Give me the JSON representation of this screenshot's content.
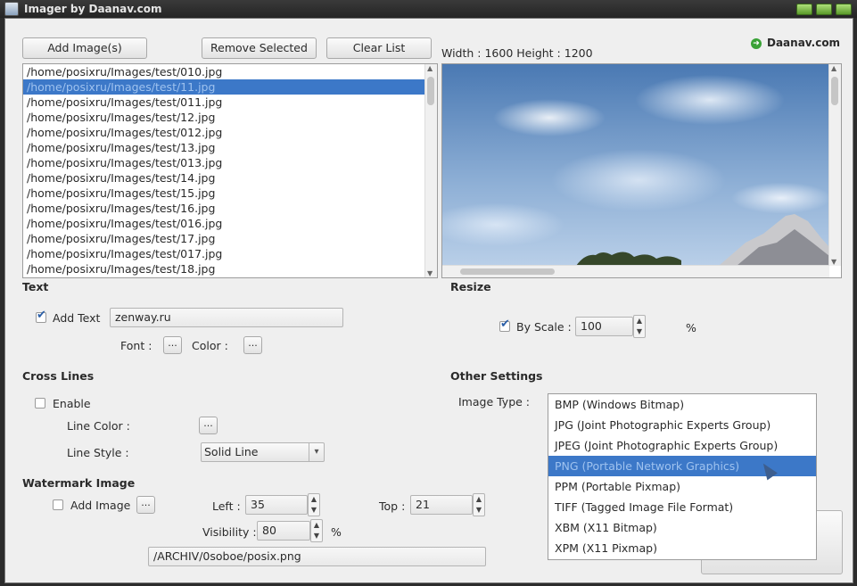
{
  "window": {
    "title": "Imager by Daanav.com"
  },
  "toolbar": {
    "add": "Add Image(s)",
    "remove": "Remove Selected",
    "clear": "Clear List"
  },
  "brand": "Daanav.com",
  "preview": {
    "dims": "Width : 1600 Height : 1200"
  },
  "files": [
    "/home/posixru/Images/test/010.jpg",
    "/home/posixru/Images/test/11.jpg",
    "/home/posixru/Images/test/011.jpg",
    "/home/posixru/Images/test/12.jpg",
    "/home/posixru/Images/test/012.jpg",
    "/home/posixru/Images/test/13.jpg",
    "/home/posixru/Images/test/013.jpg",
    "/home/posixru/Images/test/14.jpg",
    "/home/posixru/Images/test/15.jpg",
    "/home/posixru/Images/test/16.jpg",
    "/home/posixru/Images/test/016.jpg",
    "/home/posixru/Images/test/17.jpg",
    "/home/posixru/Images/test/017.jpg",
    "/home/posixru/Images/test/18.jpg"
  ],
  "selected_file_index": 1,
  "text_section": {
    "heading": "Text",
    "add_text_label": "Add Text",
    "add_text_checked": true,
    "text_value": "zenway.ru",
    "font_label": "Font :",
    "color_label": "Color :",
    "dots": "..."
  },
  "cross_lines": {
    "heading": "Cross Lines",
    "enable_label": "Enable",
    "enable_checked": false,
    "line_color_label": "Line Color :",
    "line_style_label": "Line Style :",
    "line_style_value": "Solid Line"
  },
  "watermark": {
    "heading": "Watermark Image",
    "add_image_label": "Add Image",
    "add_image_checked": false,
    "left_label": "Left :",
    "left_value": "35",
    "top_label": "Top :",
    "top_value": "21",
    "visibility_label": "Visibility :",
    "visibility_value": "80",
    "percent": "%",
    "path": "/ARCHIV/0soboe/posix.png"
  },
  "resize": {
    "heading": "Resize",
    "by_scale_label": "By Scale :",
    "by_scale_checked": true,
    "scale_value": "100",
    "percent": "%"
  },
  "other": {
    "heading": "Other Settings",
    "image_type_label": "Image Type :",
    "options": [
      "BMP (Windows Bitmap)",
      "JPG (Joint Photographic Experts Group)",
      "JPEG (Joint Photographic Experts Group)",
      "PNG (Portable Network Graphics)",
      "PPM (Portable Pixmap)",
      "TIFF (Tagged Image File Format)",
      "XBM (X11 Bitmap)",
      "XPM (X11 Pixmap)"
    ],
    "highlighted_index": 3
  }
}
